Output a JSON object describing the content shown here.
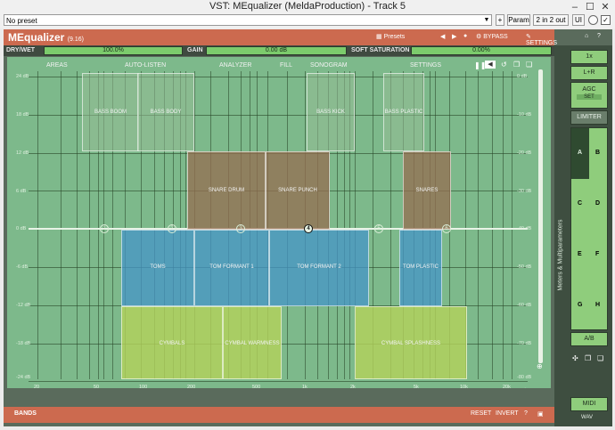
{
  "window": {
    "title": "VST: MEqualizer (MeldaProduction) - Track 5",
    "minimize": "–",
    "maximize": "☐",
    "close": "✕"
  },
  "toolbar": {
    "preset": "No preset",
    "plus": "+",
    "param": "Param",
    "io": "2 in 2 out",
    "ui": "UI"
  },
  "header": {
    "logo": "MEqualizer",
    "version": "(9.16)",
    "presets": "Presets",
    "bypass": "BYPASS",
    "settings": "SETTINGS"
  },
  "controls": {
    "drywet_label": "DRY/WET",
    "drywet_value": "100.0%",
    "gain_label": "GAIN",
    "gain_value": "0.00 dB",
    "sat_label": "SOFT SATURATION",
    "sat_value": "0.00%"
  },
  "tabs": [
    "AREAS",
    "AUTO-LISTEN",
    "ANALYZER",
    "FILL",
    "SONOGRAM",
    "SETTINGS"
  ],
  "db_left": [
    "24 dB",
    "18 dB",
    "12 dB",
    "6 dB",
    "0 dB",
    "-6 dB",
    "-12 dB",
    "-18 dB",
    "-24 dB"
  ],
  "db_right": [
    "0 dB",
    "-10 dB",
    "-20 dB",
    "-30 dB",
    "-40 dB",
    "-50 dB",
    "-60 dB",
    "-70 dB",
    "-80 dB"
  ],
  "freq": [
    "20",
    "50",
    "100",
    "200",
    "500",
    "1k",
    "2k",
    "5k",
    "10k",
    "20k"
  ],
  "zones": [
    {
      "label": "BASS BOOM",
      "color": "rgba(150,190,150,0.55)"
    },
    {
      "label": "BASS BODY",
      "color": "rgba(150,190,150,0.55)"
    },
    {
      "label": "BASS KICK",
      "color": "rgba(150,190,150,0.55)"
    },
    {
      "label": "BASS PLASTIC",
      "color": "rgba(150,190,150,0.55)"
    },
    {
      "label": "SNARE DRUM",
      "color": "rgba(150,110,80,0.75)"
    },
    {
      "label": "SNARE PUNCH",
      "color": "rgba(150,110,80,0.75)"
    },
    {
      "label": "SNARES",
      "color": "rgba(150,110,80,0.75)"
    },
    {
      "label": "TOMS",
      "color": "rgba(70,150,200,0.75)"
    },
    {
      "label": "TOM FORMANT 1",
      "color": "rgba(70,150,200,0.75)"
    },
    {
      "label": "TOM FORMANT 2",
      "color": "rgba(70,150,200,0.75)"
    },
    {
      "label": "TOM PLASTIC",
      "color": "rgba(70,150,200,0.75)"
    },
    {
      "label": "CYMBALS",
      "color": "rgba(180,210,90,0.8)"
    },
    {
      "label": "CYMBAL WARMNESS",
      "color": "rgba(180,210,90,0.8)"
    },
    {
      "label": "CYMBAL SPLASHNESS",
      "color": "rgba(180,210,90,0.8)"
    }
  ],
  "bands": [
    "1",
    "2",
    "3",
    "4",
    "5",
    "6"
  ],
  "footer": {
    "bands": "BANDS",
    "reset": "RESET",
    "invert": "INVERT",
    "help": "?"
  },
  "sidebar": {
    "one_x": "1x",
    "lr": "L+R",
    "agc": "AGC",
    "set": "SET",
    "limiter": "LIMITER",
    "a": "A",
    "b": "B",
    "c": "C",
    "d": "D",
    "e": "E",
    "f": "F",
    "g": "G",
    "h": "H",
    "ab": "A/B",
    "midi": "MIDI",
    "wav": "WAV",
    "meters": "Meters & Multiparameters"
  }
}
